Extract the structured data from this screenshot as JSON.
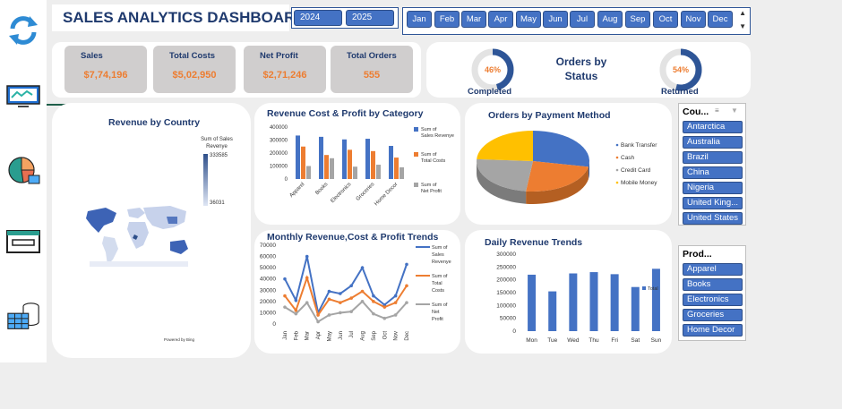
{
  "title": "SALES ANALYTICS DASHBOARD",
  "years": [
    "2024",
    "2025"
  ],
  "months": [
    "Jan",
    "Feb",
    "Mar",
    "Apr",
    "May",
    "Jun",
    "Jul",
    "Aug",
    "Sep",
    "Oct",
    "Nov",
    "Dec"
  ],
  "sidebar": [
    "refresh-icon",
    "monitor-icon",
    "pie-chart-icon",
    "window-icon",
    "database-table-icon"
  ],
  "kpis": [
    {
      "label": "Sales",
      "value": "$7,74,196"
    },
    {
      "label": "Total Costs",
      "value": "$5,02,950"
    },
    {
      "label": "Net Profit",
      "value": "$2,71,246"
    },
    {
      "label": "Total Orders",
      "value": "555"
    }
  ],
  "status": {
    "title": "Orders by Status",
    "completed": {
      "label": "Completed",
      "pct": "46%",
      "value": 0.46
    },
    "returned": {
      "label": "Returned",
      "pct": "54%",
      "value": 0.54
    }
  },
  "map": {
    "title": "Revenue by Country",
    "legend_title": "Sum of Sales Revenye",
    "max": "333585",
    "min": "36031",
    "credit": "Powered by Bing"
  },
  "colors": {
    "blue": "#4472c4",
    "orange": "#ed7d31",
    "gray": "#a5a5a5",
    "yellow": "#ffc000",
    "navy": "#1f3a6e"
  },
  "chart_data": [
    {
      "type": "bar",
      "title": "Revenue Cost & Profit by Category",
      "categories": [
        "Apparel",
        "Books",
        "Electronics",
        "Groceries",
        "Home Decor"
      ],
      "series": [
        {
          "name": "Sum of Sales Revenye",
          "values": [
            335000,
            325000,
            305000,
            310000,
            255000
          ]
        },
        {
          "name": "Sum of Total Costs",
          "values": [
            250000,
            185000,
            225000,
            215000,
            165000
          ]
        },
        {
          "name": "Sum of Net Profit",
          "values": [
            100000,
            160000,
            95000,
            110000,
            90000
          ]
        }
      ],
      "yticks": [
        "0",
        "100000",
        "200000",
        "300000",
        "400000"
      ],
      "ylim": [
        0,
        400000
      ]
    },
    {
      "type": "pie",
      "title": "Orders by Payment Method",
      "labels": [
        "Bank Transfer",
        "Cash",
        "Credit Card",
        "Mobile Money"
      ],
      "values": [
        28,
        24,
        24,
        24
      ]
    },
    {
      "type": "line",
      "title": "Monthly Revenue,Cost & Profit Trends",
      "x": [
        "Jan",
        "Feb",
        "Mar",
        "Apr",
        "May",
        "Jun",
        "Jul",
        "Aug",
        "Sep",
        "Oct",
        "Nov",
        "Dec"
      ],
      "series": [
        {
          "name": "Sum of Sales Revenye",
          "values": [
            40000,
            21000,
            60000,
            10000,
            29000,
            27000,
            34000,
            50000,
            25000,
            17000,
            25000,
            53000
          ]
        },
        {
          "name": "Sum of Total Costs",
          "values": [
            25000,
            12000,
            41000,
            8000,
            22000,
            19000,
            23000,
            29000,
            20000,
            15000,
            19000,
            34000
          ]
        },
        {
          "name": "Sum of Net Profit",
          "values": [
            15000,
            9000,
            19000,
            2000,
            8000,
            10000,
            11000,
            20000,
            9000,
            5000,
            8000,
            19000
          ]
        }
      ],
      "yticks": [
        "0",
        "10000",
        "20000",
        "30000",
        "40000",
        "50000",
        "60000",
        "70000"
      ],
      "ylim": [
        0,
        70000
      ]
    },
    {
      "type": "bar",
      "title": "Daily Revenue Trends",
      "categories": [
        "Mon",
        "Tue",
        "Wed",
        "Thu",
        "Fri",
        "Sat",
        "Sun"
      ],
      "series": [
        {
          "name": "Total",
          "values": [
            220000,
            155000,
            225000,
            230000,
            222000,
            172000,
            243000
          ]
        }
      ],
      "yticks": [
        "0",
        "50000",
        "100000",
        "150000",
        "200000",
        "250000",
        "300000"
      ],
      "ylim": [
        0,
        300000
      ]
    }
  ],
  "slicers": {
    "country": {
      "header": "Cou...",
      "items": [
        "Antarctica",
        "Australia",
        "Brazil",
        "China",
        "Nigeria",
        "United King...",
        "United States"
      ]
    },
    "product": {
      "header": "Prod...",
      "items": [
        "Apparel",
        "Books",
        "Electronics",
        "Groceries",
        "Home Decor"
      ]
    }
  }
}
